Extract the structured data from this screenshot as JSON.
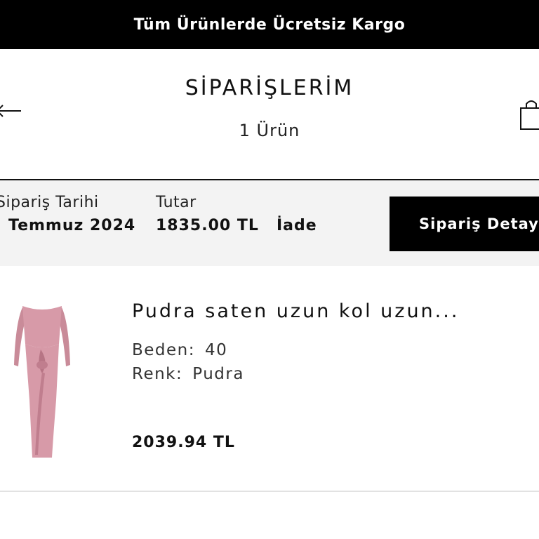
{
  "promo_banner": {
    "text": "Tüm Ürünlerde Ücretsiz Kargo"
  },
  "header": {
    "title": "SİPARİŞLERİM",
    "subtitle": "1 Ürün",
    "back_icon": "back-arrow-icon",
    "cart_icon": "shopping-bag-icon"
  },
  "order": {
    "date_label": "Sipariş Tarihi",
    "date_value": "Temmuz 2024",
    "total_label": "Tutar",
    "total_value": "1835.00 TL",
    "status": "İade",
    "detail_button": "Sipariş Detay"
  },
  "product": {
    "name": "Pudra saten uzun kol uzun...",
    "size_label": "Beden:",
    "size_value": "40",
    "color_label": "Renk:",
    "color_value": "Pudra",
    "price": "2039.94 TL",
    "image_icon": "dress-image",
    "dress_color": "#d79aa8"
  },
  "colors": {
    "banner_bg": "#000000",
    "order_bar_bg": "#f3f3f3",
    "button_bg": "#000000"
  }
}
